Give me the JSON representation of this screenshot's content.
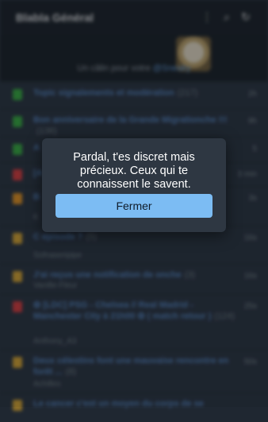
{
  "appbar": {
    "title": "Blabla Général",
    "icons": [
      "more-vert-icon",
      "search-icon",
      "refresh-icon"
    ]
  },
  "banner": {
    "prefix": "Un câlin pour votre",
    "user": "@Sneaky"
  },
  "topics": [
    {
      "title": "Topic signalements et modération",
      "count": "(217)",
      "time": "2h",
      "icon_color": "#3fb950",
      "sub": ""
    },
    {
      "title": "Bon anniversaire de la Grande Migrationche !!!",
      "count": "(136)",
      "time": "9h",
      "icon_color": "#3fb950",
      "sub": ""
    },
    {
      "title": "A",
      "count": "",
      "time": "5",
      "icon_color": "#3fb950",
      "sub": ""
    },
    {
      "title": "[A",
      "count": "",
      "time": "3 min",
      "icon_color": "#e5484d",
      "sub": ""
    },
    {
      "title": "B",
      "count": "",
      "time": "3s",
      "icon_color": "#f0a030",
      "sub": "K"
    },
    {
      "title": "C episode ?",
      "count": "(5)",
      "time": "16s",
      "icon_color": "#e3b341",
      "sub": "Sofnaseripipe"
    },
    {
      "title": "J'ai reçus une notification de onche",
      "count": "(3)",
      "time": "16s",
      "icon_color": "#e3b341",
      "sub": "Vanille-Fleur"
    },
    {
      "title": "✿ [LDC] PSG - Chelsea // Real Madrid - Manchester City à 21h00 ✿ ( match retour )",
      "count": "(124)",
      "time": "25s",
      "icon_color": "#e5484d",
      "sub": "Anthony_A3"
    },
    {
      "title": "Deux célestins font une mauvaise rencontre en forêt ...",
      "count": "(8)",
      "time": "50s",
      "icon_color": "#e3b341",
      "sub": "Achilles"
    },
    {
      "title": "Le cancer c'est un moyen du corps de se",
      "count": "",
      "time": "",
      "icon_color": "#e3b341",
      "sub": ""
    }
  ],
  "modal": {
    "message": "Pardal, t'es discret mais précieux. Ceux qui te connaissent le savent.",
    "button_label": "Fermer"
  }
}
